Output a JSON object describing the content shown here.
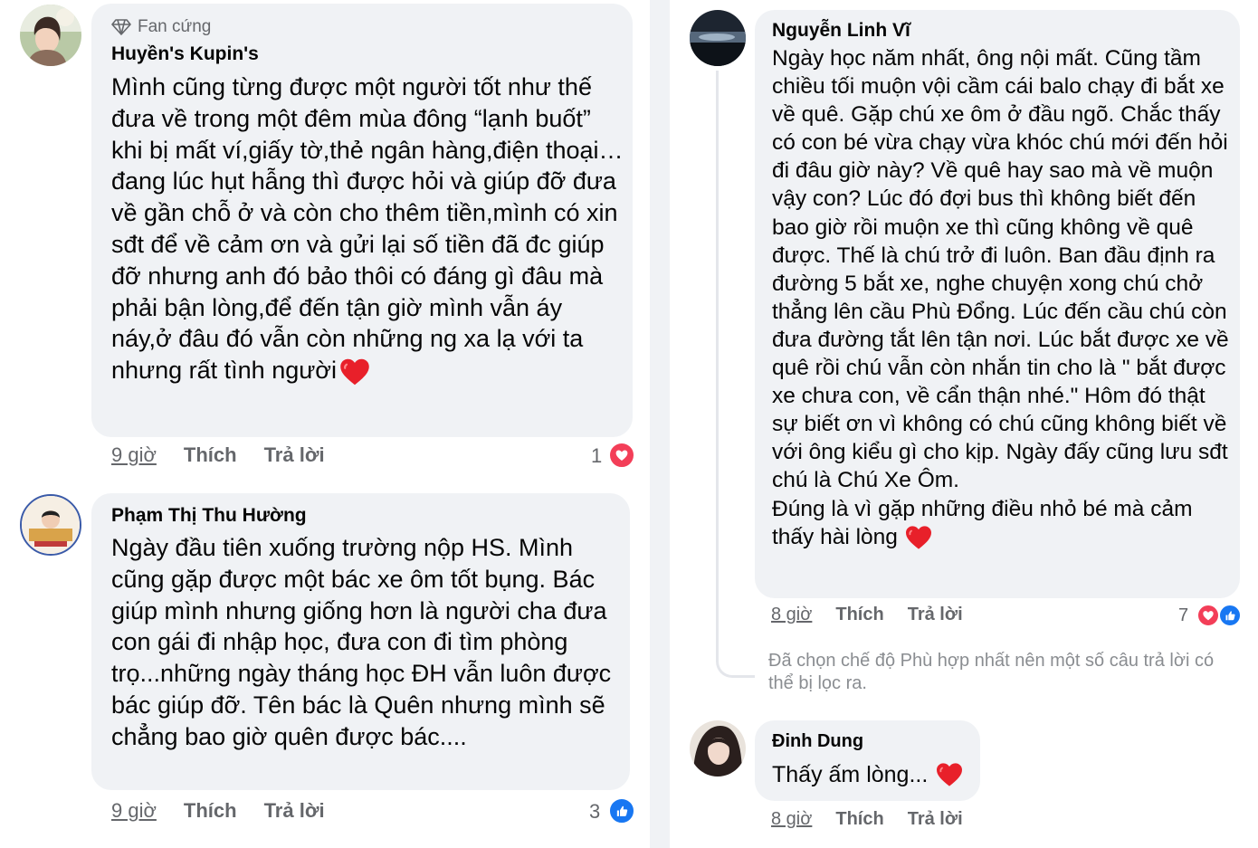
{
  "comments_left": [
    {
      "badge": "Fan cứng",
      "author": "Huyền's Kupin's",
      "text": "Mình cũng từng được một người tốt như thế đưa về trong một đêm mùa đông “lạnh buốt” khi bị mất ví,giấy tờ,thẻ ngân hàng,điện thoại…đang lúc hụt hẫng thì được hỏi và giúp đỡ đưa về gần chỗ ở và còn cho thêm tiền,mình có xin sđt để về cảm ơn và gửi lại số tiền đã đc giúp đỡ nhưng anh đó bảo thôi có đáng gì đâu mà phải bận lòng,để đến tận giờ mình vẫn áy náy,ở đâu đó vẫn còn những ng xa lạ với ta nhưng rất tình người",
      "time": "9 giờ",
      "like": "Thích",
      "reply": "Trả lời",
      "reaction_count": "1"
    },
    {
      "author": "Phạm Thị Thu Hường",
      "text": "Ngày đầu tiên xuống trường nộp HS. Mình cũng gặp được một bác xe ôm tốt bụng. Bác giúp mình nhưng giống hơn là người cha đưa con gái đi nhập học, đưa con đi tìm phòng trọ...những ngày tháng học ĐH vẫn luôn được bác giúp đỡ. Tên bác là Quên nhưng mình sẽ chẳng bao giờ quên được bác....",
      "time": "9 giờ",
      "like": "Thích",
      "reply": "Trả lời",
      "reaction_count": "3"
    }
  ],
  "comments_right": [
    {
      "author": "Nguyễn Linh Vĩ",
      "text": "Ngày học năm nhất, ông nội mất. Cũng tầm chiều tối muộn vội cầm cái balo chạy đi bắt xe về quê. Gặp chú xe ôm ở đầu ngõ. Chắc thấy có con bé vừa chạy vừa khóc chú mới đến hỏi đi đâu giờ này? Về quê hay sao mà về muộn vậy con? Lúc đó đợi bus thì không biết đến bao giờ rồi muộn xe thì cũng không về quê được. Thế là chú trở đi luôn. Ban đầu định ra đường 5 bắt xe, nghe chuyện xong chú chở thẳng lên cầu Phù Đổng. Lúc đến cầu chú còn đưa đường tắt lên tận nơi. Lúc bắt được xe về quê rồi chú vẫn còn nhắn tin cho là \" bắt được xe chưa con, về cẩn thận nhé.\" Hôm đó thật sự biết ơn vì không có chú cũng không biết về với ông kiểu gì cho kịp. Ngày đấy cũng lưu sđt chú là Chú Xe Ôm.",
      "text2": "Đúng là vì gặp những điều nhỏ bé mà cảm thấy hài lòng",
      "time": "8 giờ",
      "like": "Thích",
      "reply": "Trả lời",
      "reaction_count": "7"
    },
    {
      "author": "Đinh Dung",
      "text": "Thấy ấm lòng...",
      "time": "8 giờ",
      "like": "Thích",
      "reply": "Trả lời"
    }
  ],
  "filter_note": "Đã chọn chế độ Phù hợp nhất nên một số câu trả lời có thể bị lọc ra.",
  "colors": {
    "bubble": "#f0f2f5",
    "meta": "#65676b",
    "heart": "#f33e58",
    "like": "#1877f2"
  }
}
